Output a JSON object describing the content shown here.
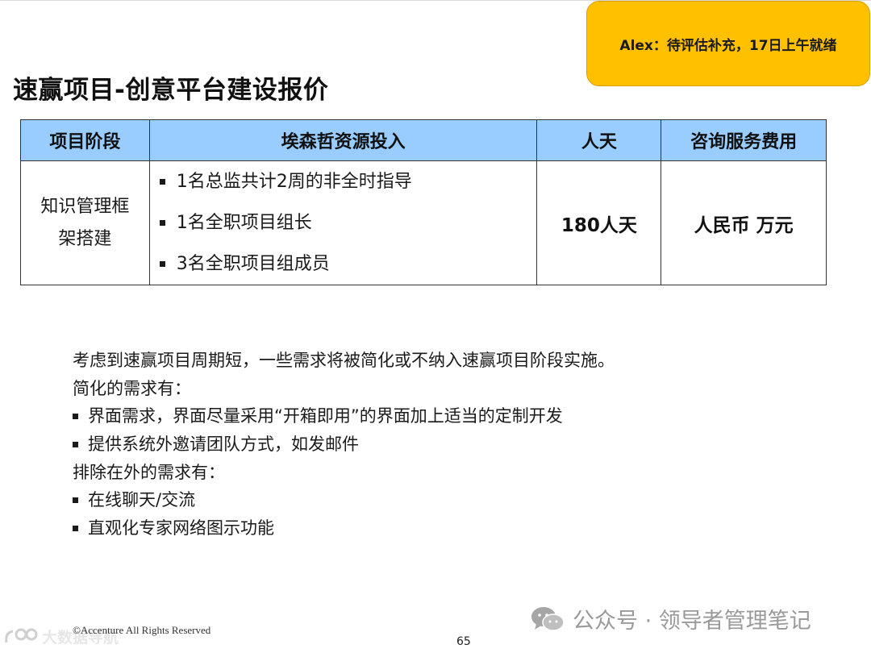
{
  "note": {
    "text": "Alex：待评估补充，17日上午就绪"
  },
  "slide": {
    "title": "速赢项目-创意平台建设报价"
  },
  "table": {
    "headers": [
      "项目阶段",
      "埃森哲资源投入",
      "人天",
      "咨询服务费用"
    ],
    "row": {
      "phase": [
        "知识管理框",
        "架搭建"
      ],
      "resources": [
        "1名总监共计2周的非全时指导",
        "1名全职项目组长",
        "3名全职项目组成员"
      ],
      "days": "180人天",
      "fee": "人民币 万元"
    }
  },
  "body": {
    "intro": "考虑到速赢项目周期短，一些需求将被简化或不纳入速赢项目阶段实施。",
    "simplified_heading": "简化的需求有：",
    "simplified_items": [
      "界面需求，界面尽量采用“开箱即用”的界面加上适当的定制开发",
      "提供系统外邀请团队方式，如发邮件"
    ],
    "excluded_heading": "排除在外的需求有：",
    "excluded_items": [
      "在线聊天/交流",
      "直观化专家网络图示功能"
    ]
  },
  "footer": {
    "watermark": "公众号 · 领导者管理笔记",
    "copyright": "©Accenture   All Rights Reserved",
    "corner_logo_text": "大数据导航",
    "page_number": "65"
  },
  "icons": {
    "wechat": "wechat-icon",
    "corner_logo": "logo-icon",
    "bullet": "square-bullet-icon"
  }
}
